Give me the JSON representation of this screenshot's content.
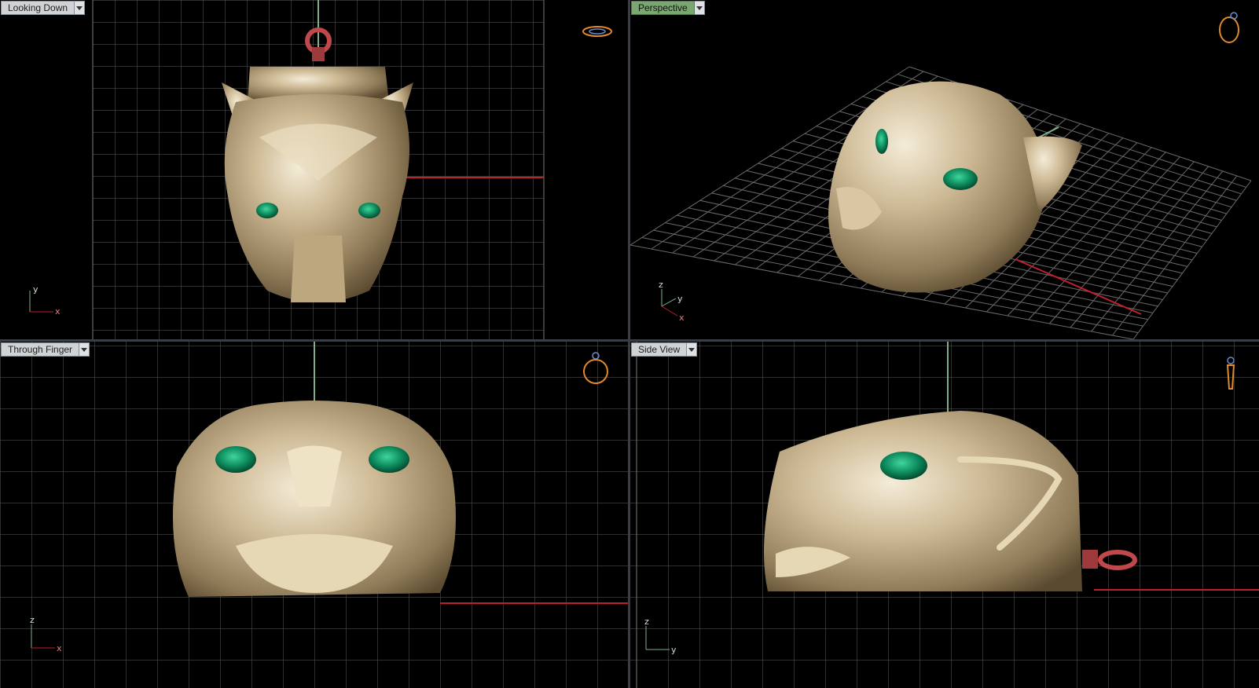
{
  "viewports": [
    {
      "id": "top",
      "title": "Looking Down",
      "active": false,
      "axes": {
        "vertical": "y",
        "horizontal": "x"
      }
    },
    {
      "id": "persp",
      "title": "Perspective",
      "active": true,
      "axes": {
        "vertical": "z",
        "second": "y",
        "horizontal": "x"
      }
    },
    {
      "id": "front",
      "title": "Through Finger",
      "active": false,
      "axes": {
        "vertical": "z",
        "horizontal": "x"
      }
    },
    {
      "id": "side",
      "title": "Side View",
      "active": false,
      "axes": {
        "vertical": "z",
        "horizontal": "y"
      }
    }
  ],
  "colors": {
    "background": "#000000",
    "grid": "#6b6b6b",
    "grid_major": "#9a9a9a",
    "x_axis": "#c0202a",
    "y_axis": "#7fb08a",
    "model_metal": "#c8b48c",
    "gem": "#0f8a5f",
    "bail": "#b8484a",
    "active_tab": "#7aa672"
  },
  "icons": [
    "ring-view-cube-icon",
    "dropdown-arrow-icon",
    "axis-triad-icon"
  ]
}
